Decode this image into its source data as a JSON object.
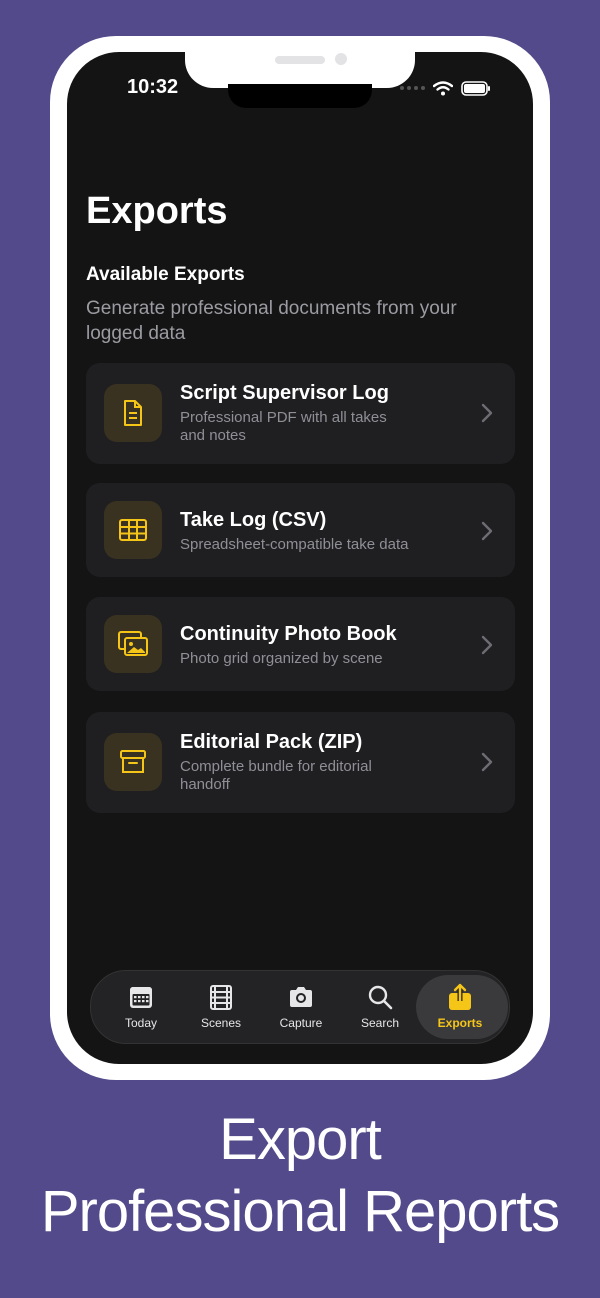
{
  "status": {
    "time": "10:32"
  },
  "page": {
    "title": "Exports"
  },
  "section": {
    "title": "Available Exports",
    "subtitle": "Generate professional documents from your logged data"
  },
  "exports": [
    {
      "title": "Script Supervisor Log",
      "subtitle": "Professional PDF with all takes and notes",
      "icon": "document-icon"
    },
    {
      "title": "Take Log (CSV)",
      "subtitle": "Spreadsheet-compatible take data",
      "icon": "table-icon"
    },
    {
      "title": "Continuity Photo Book",
      "subtitle": "Photo grid organized by scene",
      "icon": "photos-icon"
    },
    {
      "title": "Editorial Pack (ZIP)",
      "subtitle": "Complete bundle for editorial handoff",
      "icon": "archive-box-icon"
    }
  ],
  "tabs": [
    {
      "label": "Today",
      "icon": "calendar-icon"
    },
    {
      "label": "Scenes",
      "icon": "film-icon"
    },
    {
      "label": "Capture",
      "icon": "camera-icon"
    },
    {
      "label": "Search",
      "icon": "search-icon"
    },
    {
      "label": "Exports",
      "icon": "share-icon",
      "active": true
    }
  ],
  "headline": {
    "line1": "Export",
    "line2": "Professional Reports"
  },
  "colors": {
    "accent": "#f5c518",
    "background": "#524a8a",
    "screen": "#141415",
    "card": "#1f1f22"
  }
}
